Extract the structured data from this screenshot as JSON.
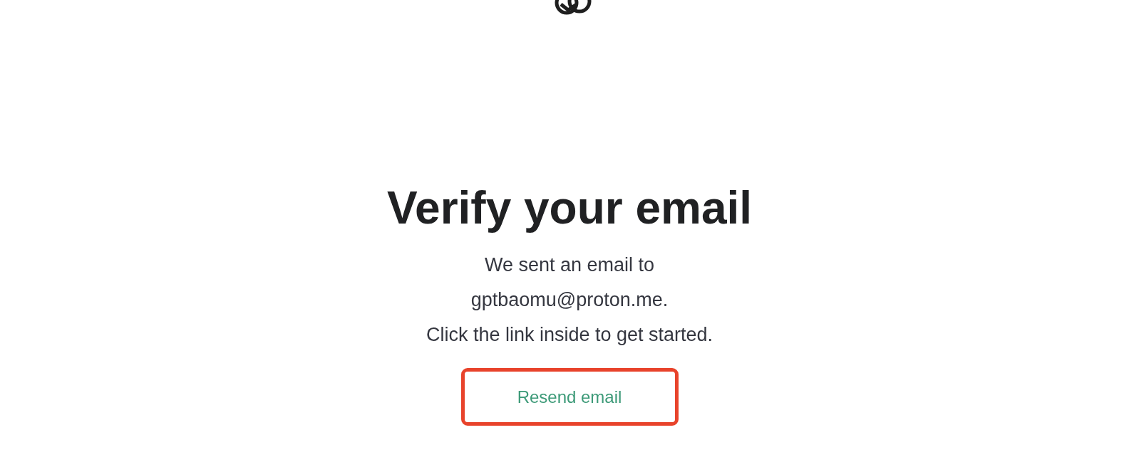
{
  "heading": "Verify your email",
  "message_lines": [
    "We sent an email to",
    "gptbaomu@proton.me.",
    "Click the link inside to get started."
  ],
  "resend_button": {
    "label": "Resend email",
    "highlighted": true
  }
}
